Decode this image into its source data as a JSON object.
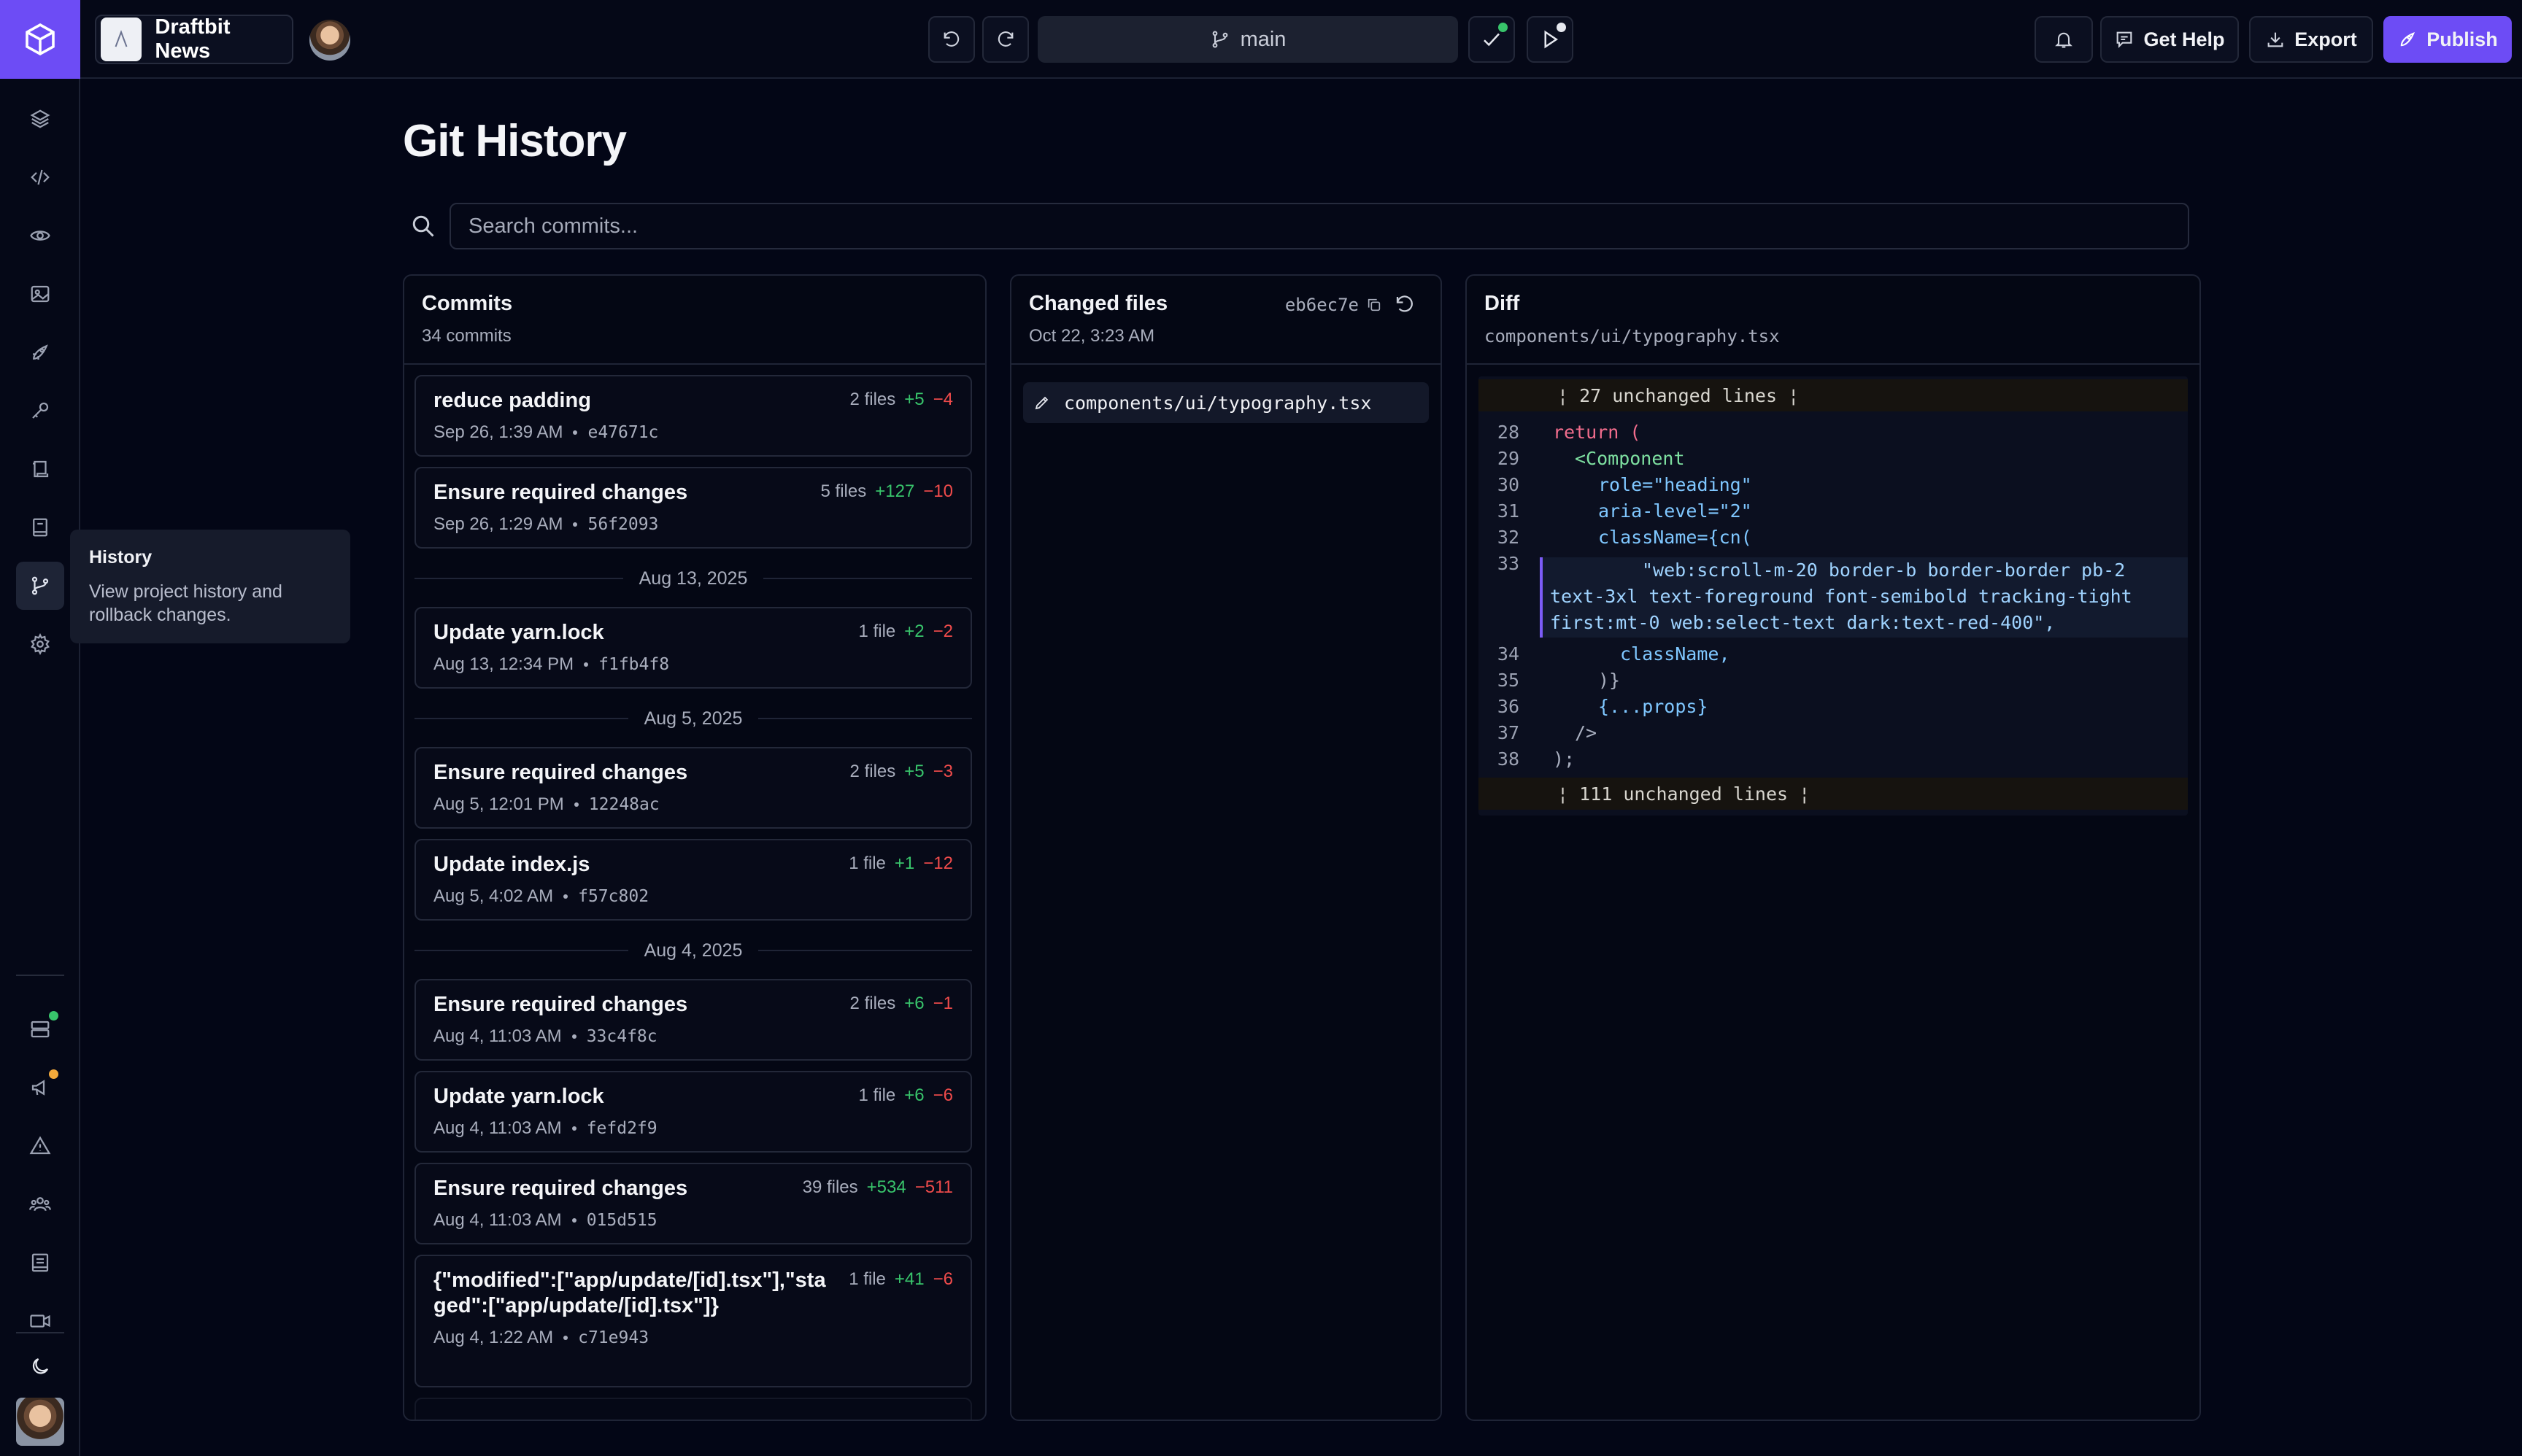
{
  "app": {
    "project_name": "Draftbit News",
    "branch": "main",
    "buttons": {
      "get_help": "Get Help",
      "export": "Export",
      "publish": "Publish"
    },
    "colors": {
      "accent": "#6d4cf5",
      "success": "#38c46b",
      "danger": "#ef4b4b",
      "warning": "#f3a93b"
    }
  },
  "rail": {
    "items": [
      {
        "icon": "layers-icon"
      },
      {
        "icon": "code-icon"
      },
      {
        "icon": "eye-icon"
      },
      {
        "icon": "image-icon"
      },
      {
        "icon": "rocket-icon"
      },
      {
        "icon": "key-icon"
      },
      {
        "icon": "scroll-icon"
      },
      {
        "icon": "book-icon"
      },
      {
        "icon": "git-branch-icon",
        "active": true
      },
      {
        "icon": "gear-icon"
      }
    ],
    "bottom_items": [
      {
        "icon": "server-icon"
      },
      {
        "icon": "megaphone-icon"
      },
      {
        "icon": "warning-icon"
      },
      {
        "icon": "users-icon"
      },
      {
        "icon": "docs-icon"
      },
      {
        "icon": "video-icon"
      },
      {
        "icon": "moon-icon"
      }
    ],
    "tooltip": {
      "title": "History",
      "body": "View project history and rollback changes."
    }
  },
  "page": {
    "title": "Git History",
    "search_placeholder": "Search commits..."
  },
  "commits_panel": {
    "title": "Commits",
    "count": "34 commits",
    "commits": [
      {
        "message": "reduce padding",
        "files": "2 files",
        "add": "+5",
        "del": "−4",
        "date": "Sep 26, 1:39 AM",
        "hash": "e47671c"
      },
      {
        "message": "Ensure required changes",
        "files": "5 files",
        "add": "+127",
        "del": "−10",
        "date": "Sep 26, 1:29 AM",
        "hash": "56f2093"
      },
      {
        "message": "Update yarn.lock",
        "files": "1 file",
        "add": "+2",
        "del": "−2",
        "date": "Aug 13, 12:34 PM",
        "hash": "f1fb4f8"
      },
      {
        "message": "Ensure required changes",
        "files": "2 files",
        "add": "+5",
        "del": "−3",
        "date": "Aug 5, 12:01 PM",
        "hash": "12248ac"
      },
      {
        "message": "Update index.js",
        "files": "1 file",
        "add": "+1",
        "del": "−12",
        "date": "Aug 5, 4:02 AM",
        "hash": "f57c802"
      },
      {
        "message": "Ensure required changes",
        "files": "2 files",
        "add": "+6",
        "del": "−1",
        "date": "Aug 4, 11:03 AM",
        "hash": "33c4f8c"
      },
      {
        "message": "Update yarn.lock",
        "files": "1 file",
        "add": "+6",
        "del": "−6",
        "date": "Aug 4, 11:03 AM",
        "hash": "fefd2f9"
      },
      {
        "message": "Ensure required changes",
        "files": "39 files",
        "add": "+534",
        "del": "−511",
        "date": "Aug 4, 11:03 AM",
        "hash": "015d515"
      },
      {
        "message": "{\"modified\":[\"app/update/[id].tsx\"],\"staged\":[\"app/update/[id].tsx\"]}",
        "files": "1 file",
        "add": "+41",
        "del": "−6",
        "date": "Aug 4, 1:22 AM",
        "hash": "c71e943"
      }
    ],
    "date_separators": [
      "Aug 13, 2025",
      "Aug 5, 2025",
      "Aug 4, 2025"
    ]
  },
  "files_panel": {
    "title": "Changed files",
    "date": "Oct 22, 3:23 AM",
    "commit_hash": "eb6ec7e",
    "files": [
      "components/ui/typography.tsx"
    ]
  },
  "diff_panel": {
    "title": "Diff",
    "path": "components/ui/typography.tsx",
    "hunk_top": "27 unchanged lines",
    "hunk_bottom": "111 unchanged lines",
    "line_numbers": [
      "28",
      "29",
      "30",
      "31",
      "32",
      "33",
      "34",
      "35",
      "36",
      "37",
      "38"
    ],
    "lines": {
      "l28": "return (",
      "l29": "<Component",
      "l30": "role=\"heading\"",
      "l31": "aria-level=\"2\"",
      "l32": "className={cn(",
      "l33a": "\"web:scroll-m-20 border-b border-border pb-2",
      "l33b": "text-3xl text-foreground font-semibold tracking-tight",
      "l33c": "first:mt-0 web:select-text dark:text-red-400\",",
      "l34": "className,",
      "l35": ")}",
      "l36": "{...props}",
      "l37": "/>",
      "l38": ");"
    }
  }
}
